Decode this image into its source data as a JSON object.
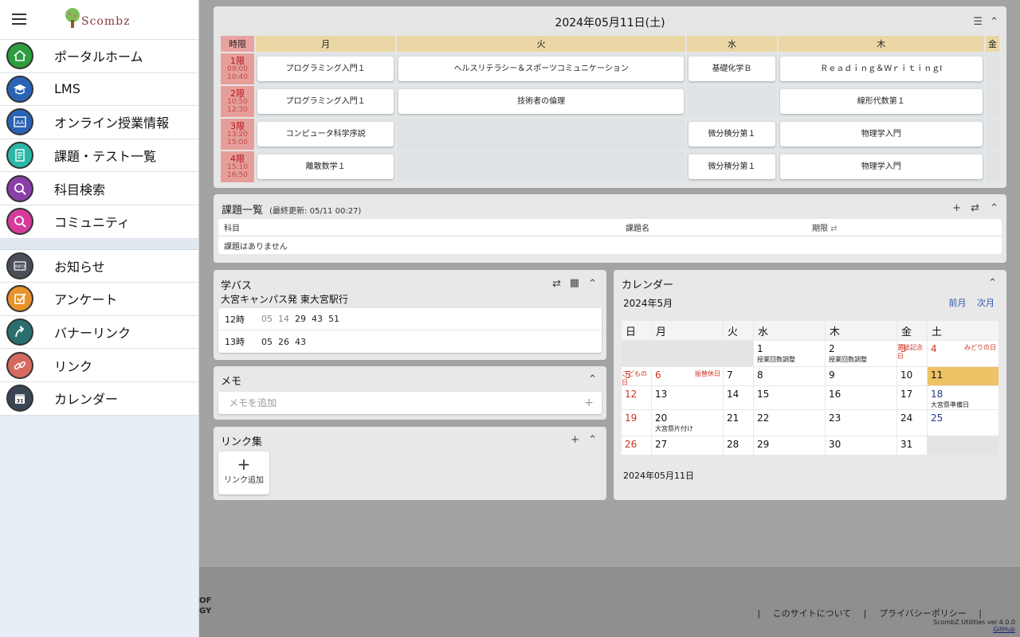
{
  "sidebar": {
    "logo_text": "Scombz",
    "items": [
      {
        "label": "ポータルホーム",
        "icon": "home-icon",
        "color": "#2e9d3f"
      },
      {
        "label": "LMS",
        "icon": "graduation-cap-icon",
        "color": "#2a63b5"
      },
      {
        "label": "オンライン授業情報",
        "icon": "classroom-icon",
        "color": "#2a63b5"
      },
      {
        "label": "課題・テスト一覧",
        "icon": "document-list-icon",
        "color": "#2bb7a8"
      },
      {
        "label": "科目検索",
        "icon": "search-icon",
        "color": "#8a3fa8"
      },
      {
        "label": "コミュニティ",
        "icon": "search-icon",
        "color": "#d63a9a"
      }
    ],
    "items2": [
      {
        "label": "お知らせ",
        "icon": "info-icon",
        "color": "#4a4f57"
      },
      {
        "label": "アンケート",
        "icon": "checkbox-icon",
        "color": "#e8932b"
      },
      {
        "label": "バナーリンク",
        "icon": "banner-arrow-icon",
        "color": "#2b6e6e"
      },
      {
        "label": "リンク",
        "icon": "link-icon",
        "color": "#d46b5e"
      },
      {
        "label": "カレンダー",
        "icon": "calendar-icon",
        "color": "#3b4654"
      }
    ]
  },
  "timetable": {
    "date": "2024年05月11日(土)",
    "period_header": "時限",
    "days": [
      "月",
      "火",
      "水",
      "木",
      "金"
    ],
    "periods": [
      {
        "name": "1限",
        "start": "09:00",
        "end": "10:40",
        "classes": [
          "プログラミング入門１",
          "ヘルスリテラシー＆スポーツコミュニケーション",
          "基礎化学Ｂ",
          "Ｒｅａｄｉｎｇ＆ＷｒｉｔｉｎｇⅠ",
          ""
        ]
      },
      {
        "name": "2限",
        "start": "10:50",
        "end": "12:30",
        "classes": [
          "プログラミング入門１",
          "技術者の倫理",
          "",
          "線形代数第１",
          ""
        ]
      },
      {
        "name": "3限",
        "start": "13:20",
        "end": "15:00",
        "classes": [
          "コンピュータ科学序説",
          "",
          "微分積分第１",
          "物理学入門",
          ""
        ]
      },
      {
        "name": "4限",
        "start": "15:10",
        "end": "16:50",
        "classes": [
          "離散数学１",
          "",
          "微分積分第１",
          "物理学入門",
          ""
        ]
      }
    ]
  },
  "tasks": {
    "title": "課題一覧",
    "updated": "(最終更新: 05/11 00:27)",
    "col_subject": "科目",
    "col_name": "課題名",
    "col_due": "期限",
    "sort_icon": "⇄",
    "empty": "課題はありません",
    "plus": "+",
    "swap": "⇄",
    "collapse": "⌃"
  },
  "bus": {
    "title": "学バス",
    "route": "大宮キャンパス発 東大宮駅行",
    "rows": [
      {
        "hour": "12時",
        "times_past": [
          "05",
          "14"
        ],
        "times": [
          "29",
          "43",
          "51"
        ]
      },
      {
        "hour": "13時",
        "times_past": [],
        "times": [
          "05",
          "26",
          "43"
        ]
      }
    ],
    "swap": "⇄",
    "collapse": "⌃"
  },
  "memo": {
    "title": "メモ",
    "placeholder": "メモを追加",
    "plus": "+",
    "collapse": "⌃"
  },
  "links": {
    "title": "リンク集",
    "add_plus": "+",
    "add_label": "リンク追加",
    "plus": "+",
    "collapse": "⌃"
  },
  "calendar": {
    "title": "カレンダー",
    "month": "2024年5月",
    "prev": "前月",
    "next": "次月",
    "weekdays": [
      "日",
      "月",
      "火",
      "水",
      "木",
      "金",
      "土"
    ],
    "weeks": [
      [
        null,
        null,
        null,
        {
          "d": "1",
          "note": "授業回数調整"
        },
        {
          "d": "2",
          "note": "授業回数調整"
        },
        {
          "d": "3",
          "hol": "憲法記念日",
          "red": true
        },
        {
          "d": "4",
          "hol": "みどりの日",
          "red": true
        }
      ],
      [
        {
          "d": "5",
          "hol": "こどもの日",
          "red": true
        },
        {
          "d": "6",
          "hol": "振替休日",
          "red": true
        },
        {
          "d": "7"
        },
        {
          "d": "8"
        },
        {
          "d": "9"
        },
        {
          "d": "10"
        },
        {
          "d": "11",
          "today": true
        }
      ],
      [
        {
          "d": "12",
          "red": true
        },
        {
          "d": "13"
        },
        {
          "d": "14"
        },
        {
          "d": "15"
        },
        {
          "d": "16"
        },
        {
          "d": "17"
        },
        {
          "d": "18",
          "blue": true,
          "note": "大宮祭準備日"
        }
      ],
      [
        {
          "d": "19",
          "red": true
        },
        {
          "d": "20",
          "note": "大宮祭片付け"
        },
        {
          "d": "21"
        },
        {
          "d": "22"
        },
        {
          "d": "23"
        },
        {
          "d": "24"
        },
        {
          "d": "25",
          "blue": true
        }
      ],
      [
        {
          "d": "26",
          "red": true
        },
        {
          "d": "27"
        },
        {
          "d": "28"
        },
        {
          "d": "29"
        },
        {
          "d": "30"
        },
        {
          "d": "31"
        },
        null
      ]
    ],
    "selected_date": "2024年05月11日",
    "collapse": "⌃"
  },
  "footer": {
    "left1": "OF",
    "left2": "GY",
    "about": "このサイトについて",
    "privacy": "プライバシーポリシー",
    "version": "ScombZ Utilities ver.4.0.0",
    "github": "GitHub"
  }
}
